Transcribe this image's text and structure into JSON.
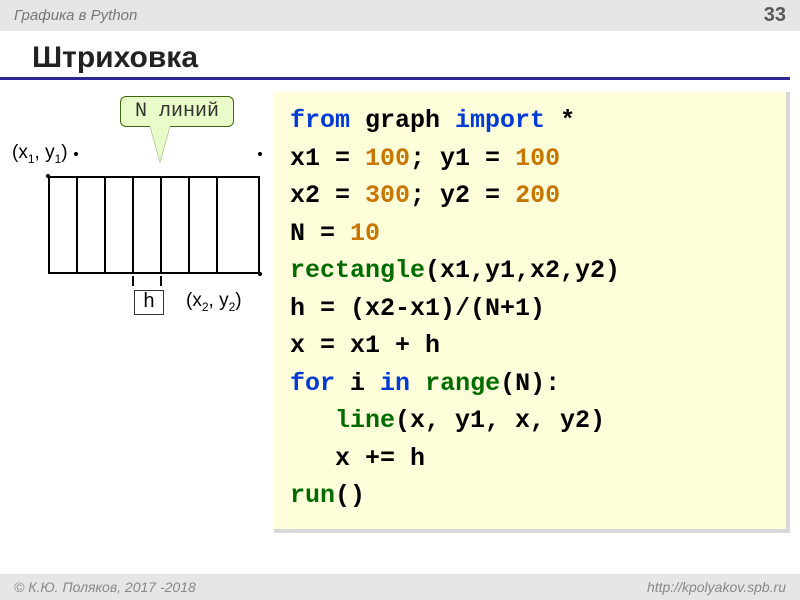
{
  "topbar": {
    "section": "Графика в Python",
    "page": "33"
  },
  "title": "Штриховка",
  "diagram": {
    "callout": "N линий",
    "coord1_prefix": "(x",
    "coord1_mid": ", y",
    "coord1_suffix": ")",
    "coord2_prefix": "(x",
    "coord2_mid": ", y",
    "coord2_suffix": ")",
    "h_label": "h",
    "sub1": "1",
    "sub2": "2"
  },
  "code": {
    "l1a": "from",
    "l1b": " graph ",
    "l1c": "import",
    "l1d": " *",
    "l2a": "x1 = ",
    "l2b": "100",
    "l2c": "; y1 = ",
    "l2d": "100",
    "l3a": "x2 = ",
    "l3b": "300",
    "l3c": "; y2 = ",
    "l3d": "200",
    "l4a": "N = ",
    "l4b": "10",
    "l5a": "rectangle",
    "l5b": "(x1,y1,x2,y2)",
    "l6": "h = (x2-x1)/(N+1)",
    "l7": "x = x1 + h",
    "l8a": "for",
    "l8b": " i ",
    "l8c": "in",
    "l8d": " ",
    "l8e": "range",
    "l8f": "(N):",
    "l9a": "   ",
    "l9b": "line",
    "l9c": "(x, y1, x, y2)",
    "l10": "   x += h",
    "l11a": "run",
    "l11b": "()"
  },
  "footer": {
    "left": "© К.Ю. Поляков, 2017 -2018",
    "right": "http://kpolyakov.spb.ru"
  }
}
